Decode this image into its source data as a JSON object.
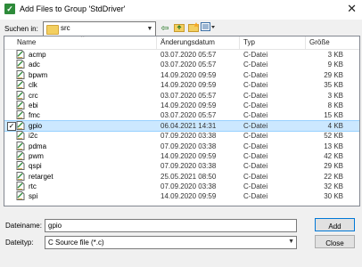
{
  "window": {
    "title": "Add Files to Group 'StdDriver'",
    "close_glyph": "✕"
  },
  "lookin": {
    "label": "Suchen in:",
    "value": "src"
  },
  "columns": {
    "name": "Name",
    "date": "Änderungsdatum",
    "type": "Typ",
    "size": "Größe"
  },
  "files": [
    {
      "name": "acmp",
      "date": "03.07.2020 05:57",
      "type": "C-Datei",
      "size": "3 KB",
      "selected": false
    },
    {
      "name": "adc",
      "date": "03.07.2020 05:57",
      "type": "C-Datei",
      "size": "9 KB",
      "selected": false
    },
    {
      "name": "bpwm",
      "date": "14.09.2020 09:59",
      "type": "C-Datei",
      "size": "29 KB",
      "selected": false
    },
    {
      "name": "clk",
      "date": "14.09.2020 09:59",
      "type": "C-Datei",
      "size": "35 KB",
      "selected": false
    },
    {
      "name": "crc",
      "date": "03.07.2020 05:57",
      "type": "C-Datei",
      "size": "3 KB",
      "selected": false
    },
    {
      "name": "ebi",
      "date": "14.09.2020 09:59",
      "type": "C-Datei",
      "size": "8 KB",
      "selected": false
    },
    {
      "name": "fmc",
      "date": "03.07.2020 05:57",
      "type": "C-Datei",
      "size": "15 KB",
      "selected": false
    },
    {
      "name": "gpio",
      "date": "06.04.2021 14:31",
      "type": "C-Datei",
      "size": "4 KB",
      "selected": true
    },
    {
      "name": "i2c",
      "date": "07.09.2020 03:38",
      "type": "C-Datei",
      "size": "52 KB",
      "selected": false
    },
    {
      "name": "pdma",
      "date": "07.09.2020 03:38",
      "type": "C-Datei",
      "size": "13 KB",
      "selected": false
    },
    {
      "name": "pwm",
      "date": "14.09.2020 09:59",
      "type": "C-Datei",
      "size": "42 KB",
      "selected": false
    },
    {
      "name": "qspi",
      "date": "07.09.2020 03:38",
      "type": "C-Datei",
      "size": "29 KB",
      "selected": false
    },
    {
      "name": "retarget",
      "date": "25.05.2021 08:50",
      "type": "C-Datei",
      "size": "22 KB",
      "selected": false
    },
    {
      "name": "rtc",
      "date": "07.09.2020 03:38",
      "type": "C-Datei",
      "size": "32 KB",
      "selected": false
    },
    {
      "name": "spi",
      "date": "14.09.2020 09:59",
      "type": "C-Datei",
      "size": "30 KB",
      "selected": false
    }
  ],
  "filename": {
    "label": "Dateiname:",
    "value": "gpio"
  },
  "filetype": {
    "label": "Dateityp:",
    "value": "C Source file (*.c)"
  },
  "buttons": {
    "add": "Add",
    "close": "Close"
  },
  "icons": {
    "app": "keil-icon",
    "folder": "folder-icon",
    "back": "back-arrow-icon",
    "up": "up-folder-icon",
    "newfolder": "new-folder-icon",
    "view": "view-menu-icon",
    "file": "c-file-icon"
  }
}
